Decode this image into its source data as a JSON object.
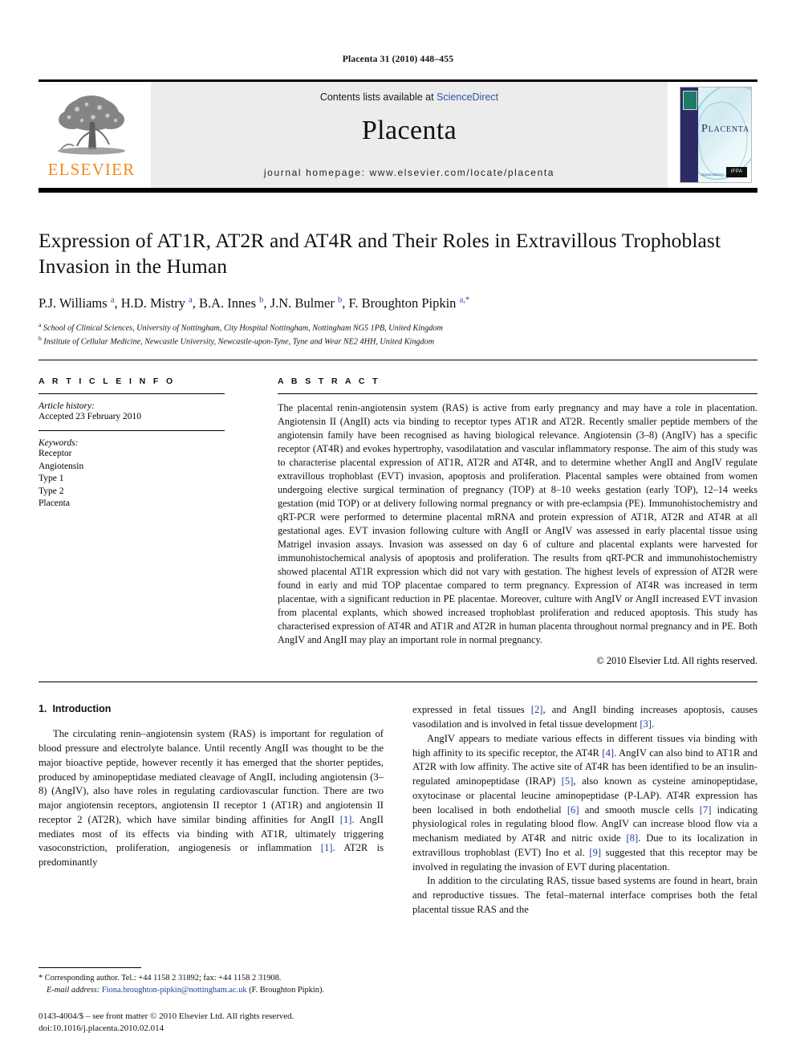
{
  "running_head": "Placenta 31 (2010) 448–455",
  "masthead": {
    "publisher_name": "ELSEVIER",
    "contents_prefix": "Contents lists available at ",
    "contents_link": "ScienceDirect",
    "journal_title": "Placenta",
    "homepage": "journal homepage: www.elsevier.com/locate/placenta",
    "cover_title": "PLACENTA",
    "cover_badge_sciencedirect": "available online at\nScienceDirect\nwww.sciencedirect.com",
    "cover_badge_ifpa": "IFPA"
  },
  "article": {
    "title": "Expression of AT1R, AT2R and AT4R and Their Roles in Extravillous Trophoblast Invasion in the Human",
    "authors_html": "P.J. Williams <sup>a</sup>, H.D. Mistry <sup>a</sup>, B.A. Innes <sup>b</sup>, J.N. Bulmer <sup>b</sup>, F. Broughton Pipkin <sup>a,*</sup>",
    "affiliation_a": "School of Clinical Sciences, University of Nottingham, City Hospital Nottingham, Nottingham NG5 1PB, United Kingdom",
    "affiliation_b": "Institute of Cellular Medicine, Newcastle University, Newcastle-upon-Tyne, Tyne and Wear NE2 4HH, United Kingdom",
    "marker_a": "a",
    "marker_b": "b"
  },
  "article_info": {
    "heading": "A R T I C L E   I N F O",
    "history_label": "Article history:",
    "history_value": "Accepted 23 February 2010",
    "keywords_label": "Keywords:",
    "keywords": [
      "Receptor",
      "Angiotensin",
      "Type 1",
      "Type 2",
      "Placenta"
    ]
  },
  "abstract": {
    "heading": "A B S T R A C T",
    "text": "The placental renin-angiotensin system (RAS) is active from early pregnancy and may have a role in placentation. Angiotensin II (AngII) acts via binding to receptor types AT1R and AT2R. Recently smaller peptide members of the angiotensin family have been recognised as having biological relevance. Angiotensin (3–8) (AngIV) has a specific receptor (AT4R) and evokes hypertrophy, vasodilatation and vascular inflammatory response. The aim of this study was to characterise placental expression of AT1R, AT2R and AT4R, and to determine whether AngII and AngIV regulate extravillous trophoblast (EVT) invasion, apoptosis and proliferation. Placental samples were obtained from women undergoing elective surgical termination of pregnancy (TOP) at 8–10 weeks gestation (early TOP), 12–14 weeks gestation (mid TOP) or at delivery following normal pregnancy or with pre-eclampsia (PE). Immunohistochemistry and qRT-PCR were performed to determine placental mRNA and protein expression of AT1R, AT2R and AT4R at all gestational ages. EVT invasion following culture with AngII or AngIV was assessed in early placental tissue using Matrigel invasion assays. Invasion was assessed on day 6 of culture and placental explants were harvested for immunohistochemical analysis of apoptosis and proliferation. The results from qRT-PCR and immunohistochemistry showed placental AT1R expression which did not vary with gestation. The highest levels of expression of AT2R were found in early and mid TOP placentae compared to term pregnancy. Expression of AT4R was increased in term placentae, with a significant reduction in PE placentae. Moreover, culture with AngIV or AngII increased EVT invasion from placental explants, which showed increased trophoblast proliferation and reduced apoptosis. This study has characterised expression of AT4R and AT1R and AT2R in human placenta throughout normal pregnancy and in PE. Both AngIV and AngII may play an important role in normal pregnancy.",
    "copyright": "© 2010 Elsevier Ltd. All rights reserved."
  },
  "introduction": {
    "number": "1.",
    "heading": "Introduction",
    "left_para_1_parts": {
      "a": "The circulating renin–angiotensin system (RAS) is important for regulation of blood pressure and electrolyte balance. Until recently AngII was thought to be the major bioactive peptide, however recently it has emerged that the shorter peptides, produced by aminopeptidase mediated cleavage of AngII, including angiotensin (3–8) (AngIV), also have roles in regulating cardiovascular function. There are two major angiotensin receptors, angiotensin II receptor 1 (AT1R) and angiotensin II receptor 2 (AT2R), which have similar binding affinities for AngII ",
      "ref1": "[1]",
      "b": ". AngII mediates most of its effects via binding with AT1R, ultimately triggering vasoconstriction, proliferation, angiogenesis or inflammation ",
      "ref2": "[1]",
      "c": ". AT2R is predominantly"
    },
    "right_para_1_parts": {
      "a": "expressed in fetal tissues ",
      "ref2": "[2]",
      "b": ", and AngII binding increases apoptosis, causes vasodilation and is involved in fetal tissue development ",
      "ref3": "[3]",
      "c": "."
    },
    "right_para_2_parts": {
      "a": "AngIV appears to mediate various effects in different tissues via binding with high affinity to its specific receptor, the AT4R ",
      "ref4": "[4]",
      "b": ". AngIV can also bind to AT1R and AT2R with low affinity. The active site of AT4R has been identified to be an insulin-regulated aminopeptidase (IRAP) ",
      "ref5": "[5]",
      "c": ", also known as cysteine aminopeptidase, oxytocinase or placental leucine aminopeptidase (P-LAP). AT4R expression has been localised in both endothelial ",
      "ref6": "[6]",
      "d": " and smooth muscle cells ",
      "ref7": "[7]",
      "e": " indicating physiological roles in regulating blood flow. AngIV can increase blood flow via a mechanism mediated by AT4R and nitric oxide ",
      "ref8": "[8]",
      "f": ". Due to its localization in extravillous trophoblast (EVT) Ino et al. ",
      "ref9": "[9]",
      "g": " suggested that this receptor may be involved in regulating the invasion of EVT during placentation."
    },
    "right_para_3": "In addition to the circulating RAS, tissue based systems are found in heart, brain and reproductive tissues. The fetal–maternal interface comprises both the fetal placental tissue RAS and the"
  },
  "footnote": {
    "star": "*",
    "corresponding": " Corresponding author. Tel.: +44 1158 2 31892; fax: +44 1158 2 31908.",
    "email_label": "E-mail address:",
    "email": "Fiona.broughton-pipkin@nottingham.ac.uk",
    "email_suffix": " (F. Broughton Pipkin).",
    "issn_line": "0143-4004/$ – see front matter © 2010 Elsevier Ltd. All rights reserved.",
    "doi_line": "doi:10.1016/j.placenta.2010.02.014"
  },
  "colors": {
    "link_blue": "#2b55a8",
    "ref_blue": "#21409a",
    "elsevier_orange": "#f08a1c",
    "masthead_grey": "#ececec",
    "cover_navy": "#2d2a66"
  }
}
